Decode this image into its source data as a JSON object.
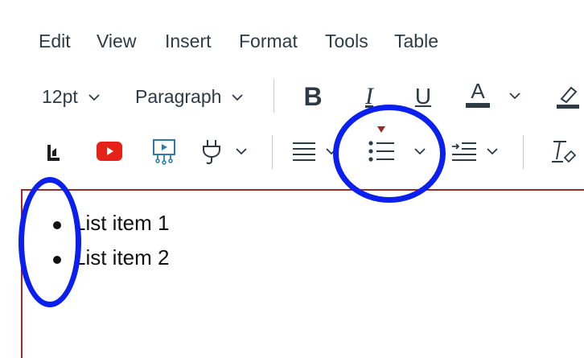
{
  "menu": {
    "items": [
      "Edit",
      "View",
      "Insert",
      "Format",
      "Tools",
      "Table"
    ]
  },
  "toolbar1": {
    "font_size": "12pt",
    "block_format": "Paragraph",
    "bold_glyph": "B",
    "italic_glyph": "I",
    "underline_glyph": "U",
    "text_color_glyph": "A"
  },
  "toolbar2": {
    "icons": [
      "lti-apps-icon",
      "youtube-icon",
      "media-icon",
      "plugin-icon",
      "align-icon",
      "bulleted-list-icon",
      "indent-icon",
      "clear-formatting-icon"
    ]
  },
  "editor": {
    "list_items": [
      "List item 1",
      "List item 2"
    ]
  },
  "colors": {
    "accent_circle": "#0a1ff0",
    "focus_border": "#9b2a2a",
    "indicator": "#9b2a2a"
  }
}
